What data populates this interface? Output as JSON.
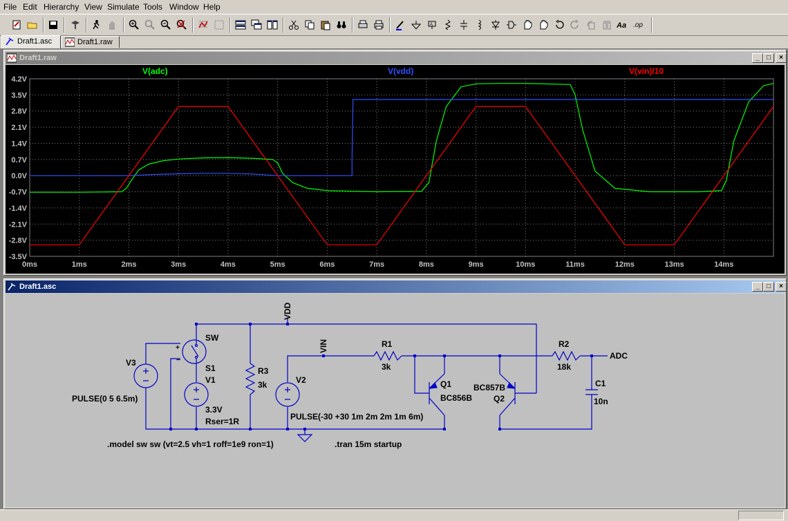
{
  "menu": [
    "File",
    "Edit",
    "Hierarchy",
    "View",
    "Simulate",
    "Tools",
    "Window",
    "Help"
  ],
  "toolbar_icons": [
    "new-schematic-icon",
    "open-icon",
    "save-icon",
    "control-panel-icon",
    "run-icon",
    "halt-icon",
    "zoom-in-icon",
    "zoom-box-icon",
    "zoom-out-icon",
    "zoom-cancel-icon",
    "autorange-icon",
    "fit-icon",
    "tile-horizontal-icon",
    "cascade-icon",
    "tile-vertical-icon",
    "cut-icon",
    "copy-icon",
    "paste-icon",
    "find-icon",
    "print-setup-icon",
    "print-icon",
    "draw-wire-icon",
    "ground-icon",
    "label-net-icon",
    "resistor-icon",
    "capacitor-icon",
    "inductor-icon",
    "diode-icon",
    "component-icon",
    "move-icon",
    "drag-icon",
    "undo-icon",
    "redo-icon",
    "rotate-icon",
    "mirror-icon",
    "text-icon",
    "spice-directive-icon"
  ],
  "tabs": [
    {
      "label": "Draft1.asc",
      "active": true
    },
    {
      "label": "Draft1.raw",
      "active": false
    }
  ],
  "waveform_window": {
    "title": "Draft1.raw"
  },
  "schematic_window": {
    "title": "Draft1.asc"
  },
  "window_buttons": {
    "minimize": "_",
    "maximize": "□",
    "close": "×"
  },
  "chart_data": {
    "type": "line",
    "background": "#000000",
    "grid": true,
    "ylim": [
      -3.5,
      4.2
    ],
    "xlim": [
      0,
      15
    ],
    "x_ticks": [
      "0ms",
      "1ms",
      "2ms",
      "3ms",
      "4ms",
      "5ms",
      "6ms",
      "7ms",
      "8ms",
      "9ms",
      "10ms",
      "11ms",
      "12ms",
      "13ms",
      "14ms"
    ],
    "y_ticks": [
      "4.2V",
      "3.5V",
      "2.8V",
      "2.1V",
      "1.4V",
      "0.7V",
      "0.0V",
      "-0.7V",
      "-1.4V",
      "-2.1V",
      "-2.8V",
      "-3.5V"
    ],
    "series": [
      {
        "name": "V(adc)",
        "color": "#00ff00",
        "x": [
          0,
          1.0,
          1.85,
          1.95,
          2.05,
          2.2,
          2.4,
          2.7,
          3.0,
          3.5,
          4.0,
          4.5,
          4.9,
          5.0,
          5.1,
          5.3,
          5.6,
          6.0,
          7.0,
          7.9,
          8.05,
          8.2,
          8.4,
          8.7,
          9.0,
          9.5,
          10.0,
          10.9,
          11.0,
          11.15,
          11.4,
          11.8,
          12.5,
          13.5,
          13.95,
          14.05,
          14.2,
          14.5,
          14.8,
          15.0
        ],
        "y": [
          -0.72,
          -0.72,
          -0.7,
          -0.55,
          -0.2,
          0.25,
          0.5,
          0.65,
          0.72,
          0.77,
          0.78,
          0.75,
          0.7,
          0.55,
          0.1,
          -0.3,
          -0.55,
          -0.65,
          -0.7,
          -0.68,
          -0.3,
          1.5,
          3.0,
          3.85,
          3.98,
          4.0,
          4.0,
          3.95,
          3.5,
          2.0,
          0.2,
          -0.55,
          -0.7,
          -0.7,
          -0.65,
          -0.2,
          1.5,
          3.2,
          3.9,
          4.0
        ]
      },
      {
        "name": "V(vdd)",
        "color": "#3050ff",
        "x": [
          0,
          2.0,
          2.5,
          3.0,
          3.5,
          4.0,
          4.5,
          5.0,
          6.5,
          6.5,
          6.52,
          15.0
        ],
        "y": [
          0.0,
          0.0,
          0.05,
          0.08,
          0.1,
          0.1,
          0.07,
          0.0,
          0.0,
          0.7,
          3.3,
          3.3
        ]
      },
      {
        "name": "V(vin)/10",
        "color": "#ff0000",
        "x": [
          0,
          1.0,
          3.0,
          4.0,
          6.0,
          7.0,
          9.0,
          10.0,
          12.0,
          13.0,
          15.0
        ],
        "y": [
          -3.0,
          -3.0,
          3.0,
          3.0,
          -3.0,
          -3.0,
          3.0,
          3.0,
          -3.0,
          -3.0,
          3.0
        ]
      }
    ]
  },
  "schematic": {
    "nets": {
      "vdd": "VDD",
      "vin": "VIN",
      "adc": "ADC"
    },
    "components": {
      "v3": {
        "ref": "V3",
        "value": "PULSE(0 5 6.5m)"
      },
      "s1": {
        "ref": "S1",
        "model": "SW"
      },
      "v1": {
        "ref": "V1",
        "value": "3.3V",
        "extra": "Rser=1R"
      },
      "r3": {
        "ref": "R3",
        "value": "3k"
      },
      "v2": {
        "ref": "V2",
        "value": "PULSE(-30 +30 1m 2m 2m 1m 6m)"
      },
      "r1": {
        "ref": "R1",
        "value": "3k"
      },
      "q1": {
        "ref": "Q1",
        "value": "BC856B"
      },
      "q2": {
        "ref": "Q2",
        "value": "BC857B"
      },
      "r2": {
        "ref": "R2",
        "value": "18k"
      },
      "c1": {
        "ref": "C1",
        "value": "10n"
      }
    },
    "directives": {
      "model": ".model sw sw (vt=2.5 vh=1 roff=1e9 ron=1)",
      "tran": ".tran 15m startup"
    },
    "pin_marks": {
      "plus": "+",
      "minus": "−"
    }
  }
}
